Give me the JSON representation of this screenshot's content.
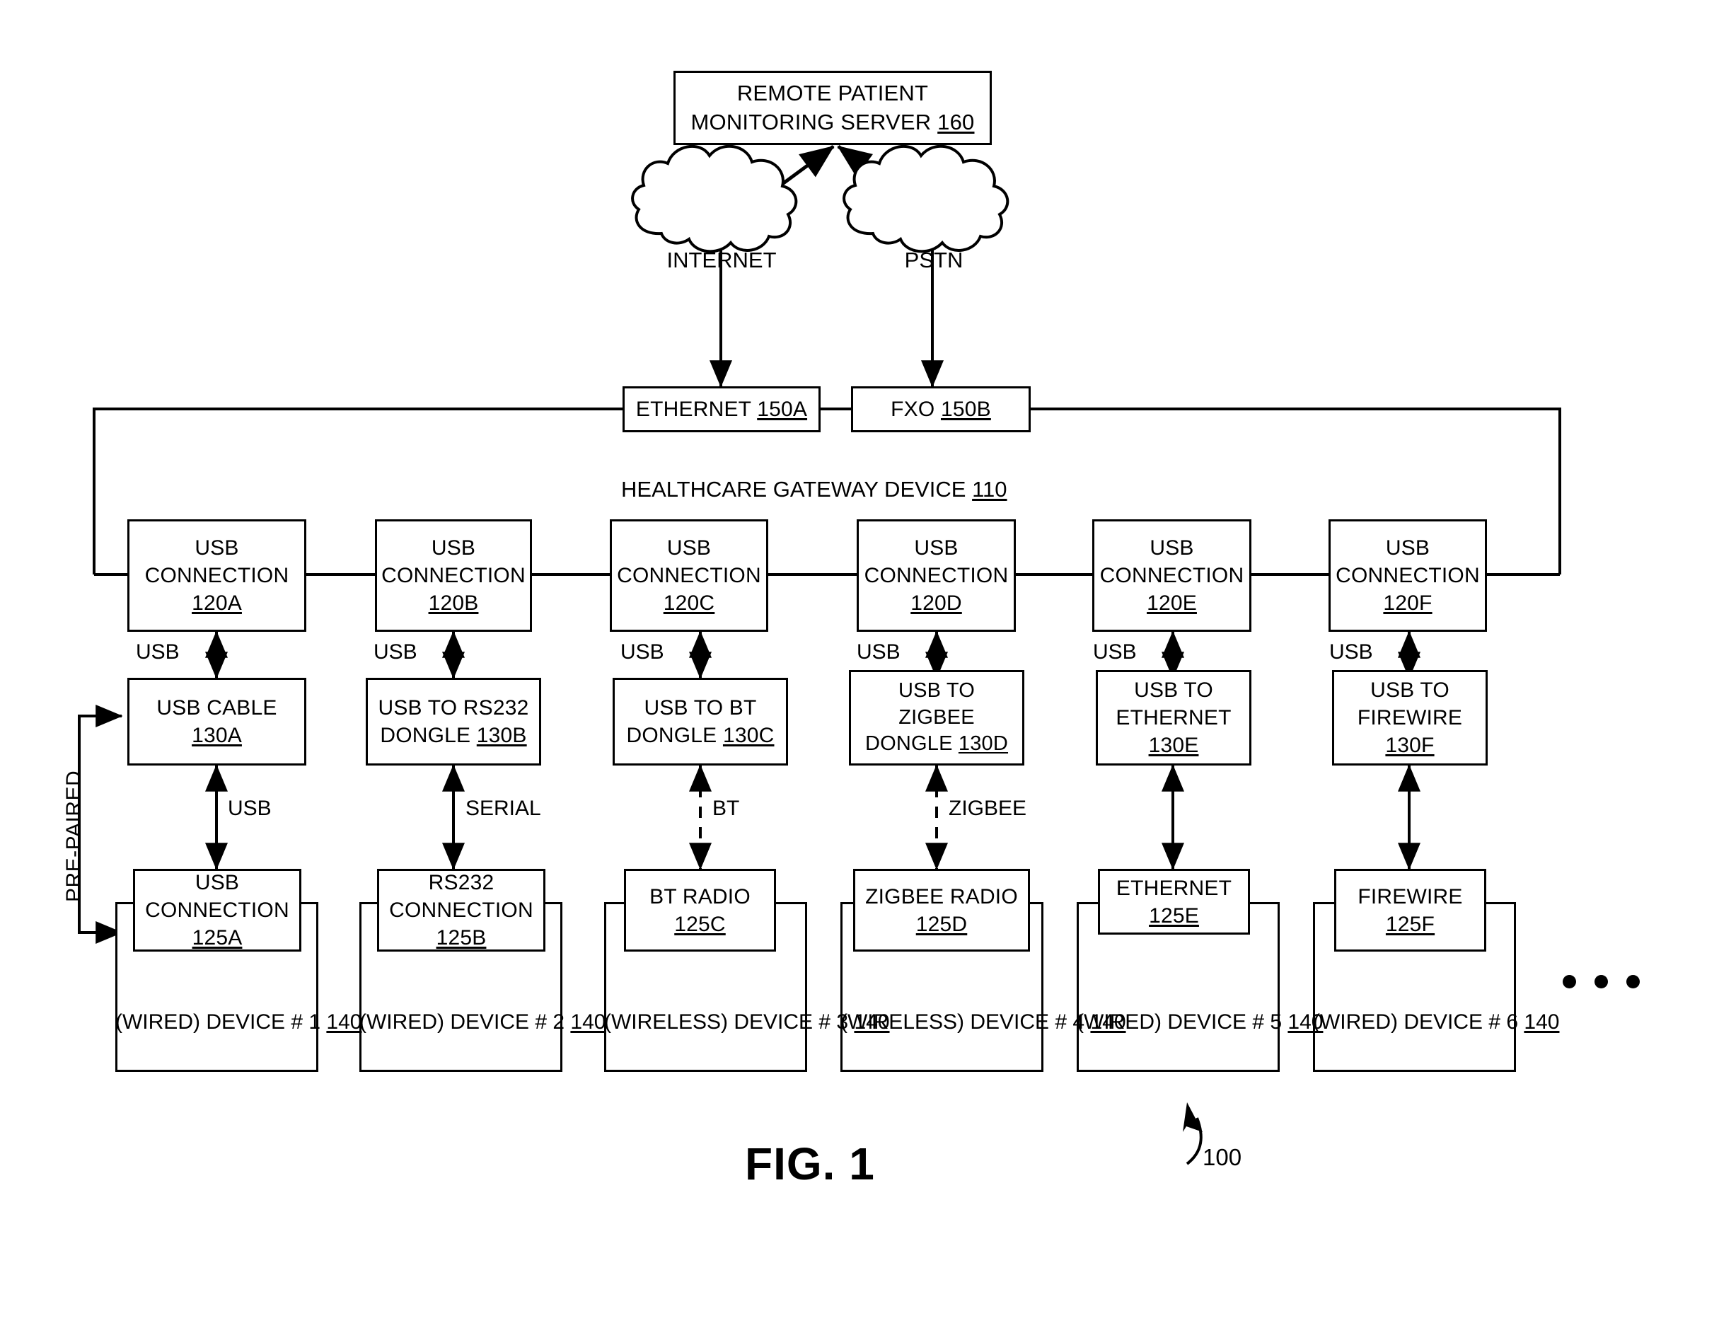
{
  "figure": {
    "caption": "FIG. 1",
    "system_ref": "100"
  },
  "server": {
    "line1": "REMOTE PATIENT",
    "line2": "MONITORING SERVER",
    "ref": "160"
  },
  "clouds": [
    {
      "label": "INTERNET",
      "name": "internet-cloud"
    },
    {
      "label": "PSTN",
      "name": "pstn-cloud"
    }
  ],
  "gateway": {
    "title": "HEALTHCARE GATEWAY DEVICE",
    "ref": "110",
    "wan_ports": [
      {
        "label": "ETHERNET",
        "ref": "150A",
        "name": "ethernet-port"
      },
      {
        "label": "FXO",
        "ref": "150B",
        "name": "fxo-port"
      }
    ]
  },
  "usb_connections": [
    {
      "line1": "USB",
      "line2": "CONNECTION",
      "ref": "120A"
    },
    {
      "line1": "USB",
      "line2": "CONNECTION",
      "ref": "120B"
    },
    {
      "line1": "USB",
      "line2": "CONNECTION",
      "ref": "120C"
    },
    {
      "line1": "USB",
      "line2": "CONNECTION",
      "ref": "120D"
    },
    {
      "line1": "USB",
      "line2": "CONNECTION",
      "ref": "120E"
    },
    {
      "line1": "USB",
      "line2": "CONNECTION",
      "ref": "120F"
    }
  ],
  "usb_bus_labels": [
    "USB",
    "USB",
    "USB",
    "USB",
    "USB",
    "USB"
  ],
  "adapters": [
    {
      "lines": [
        "USB CABLE"
      ],
      "ref": "130A",
      "ref_inline": false
    },
    {
      "lines": [
        "USB TO RS232",
        "DONGLE"
      ],
      "ref": "130B",
      "ref_inline": true
    },
    {
      "lines": [
        "USB TO BT",
        "DONGLE"
      ],
      "ref": "130C",
      "ref_inline": true
    },
    {
      "lines": [
        "USB TO",
        "ZIGBEE",
        "DONGLE"
      ],
      "ref": "130D",
      "ref_inline": true
    },
    {
      "lines": [
        "USB TO",
        "ETHERNET"
      ],
      "ref": "130E",
      "ref_inline": false
    },
    {
      "lines": [
        "USB TO",
        "FIREWIRE"
      ],
      "ref": "130F",
      "ref_inline": false
    }
  ],
  "link_labels": [
    {
      "text": "USB",
      "wireless": false
    },
    {
      "text": "SERIAL",
      "wireless": false
    },
    {
      "text": "BT",
      "wireless": true
    },
    {
      "text": "ZIGBEE",
      "wireless": true
    },
    {
      "text": "",
      "wireless": false
    },
    {
      "text": "",
      "wireless": false
    }
  ],
  "device_interfaces": [
    {
      "lines": [
        "USB",
        "CONNECTION"
      ],
      "ref": "125A"
    },
    {
      "lines": [
        "RS232",
        "CONNECTION"
      ],
      "ref": "125B"
    },
    {
      "lines": [
        "BT RADIO"
      ],
      "ref": "125C"
    },
    {
      "lines": [
        "ZIGBEE RADIO"
      ],
      "ref": "125D"
    },
    {
      "lines": [
        "ETHERNET"
      ],
      "ref": "125E"
    },
    {
      "lines": [
        "FIREWIRE"
      ],
      "ref": "125F"
    }
  ],
  "devices": [
    {
      "kind": "(WIRED)",
      "label": "DEVICE # 1",
      "ref": "140"
    },
    {
      "kind": "(WIRED)",
      "label": "DEVICE # 2",
      "ref": "140"
    },
    {
      "kind": "(WIRELESS)",
      "label": "DEVICE # 3",
      "ref": "140"
    },
    {
      "kind": "(WIRELESS)",
      "label": "DEVICE # 4",
      "ref": "140"
    },
    {
      "kind": "(WIRED)",
      "label": "DEVICE # 5",
      "ref": "140"
    },
    {
      "kind": "(WIRED)",
      "label": "DEVICE # 6",
      "ref": "140"
    }
  ],
  "annotations": {
    "pre_paired": "PRE-PAIRED",
    "continuation": "•••"
  },
  "colors": {
    "stroke": "#000000",
    "background": "#ffffff"
  }
}
